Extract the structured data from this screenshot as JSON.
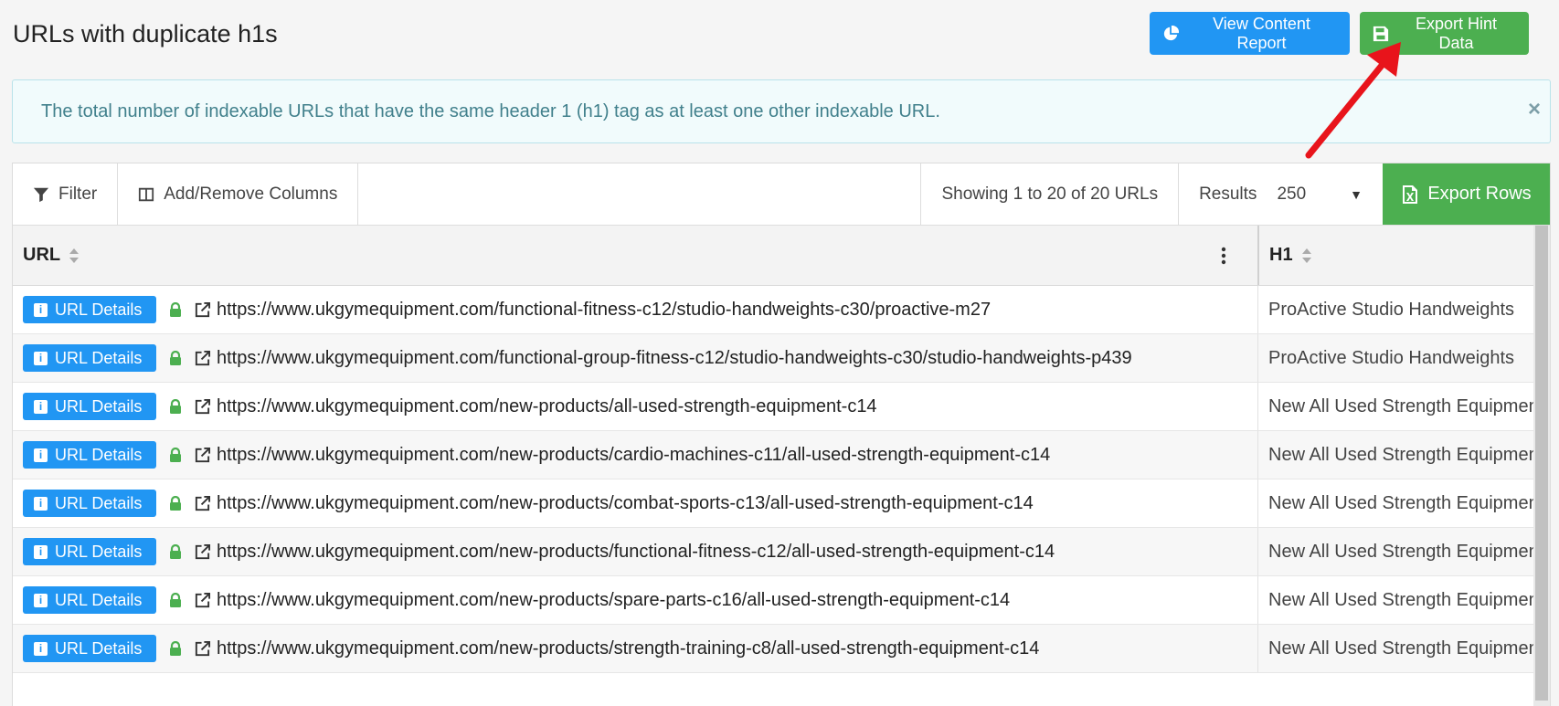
{
  "header": {
    "title": "URLs with duplicate h1s",
    "view_report_label": "View Content Report",
    "export_hint_label": "Export Hint Data"
  },
  "alert": {
    "text": "The total number of indexable URLs that have the same header 1 (h1) tag as at least one other indexable URL.",
    "close_glyph": "×"
  },
  "toolbar": {
    "filter_label": "Filter",
    "columns_label": "Add/Remove Columns",
    "showing_text": "Showing 1 to 20 of 20 URLs",
    "results_label": "Results",
    "results_value": "250",
    "export_rows_label": "Export Rows"
  },
  "table": {
    "columns": {
      "url": "URL",
      "h1": "H1"
    },
    "details_label": "URL Details",
    "rows": [
      {
        "url": "https://www.ukgymequipment.com/functional-fitness-c12/studio-handweights-c30/proactive-m27",
        "h1": "ProActive Studio Handweights"
      },
      {
        "url": "https://www.ukgymequipment.com/functional-group-fitness-c12/studio-handweights-c30/studio-handweights-p439",
        "h1": "ProActive Studio Handweights"
      },
      {
        "url": "https://www.ukgymequipment.com/new-products/all-used-strength-equipment-c14",
        "h1": "New All Used Strength Equipment"
      },
      {
        "url": "https://www.ukgymequipment.com/new-products/cardio-machines-c11/all-used-strength-equipment-c14",
        "h1": "New All Used Strength Equipment"
      },
      {
        "url": "https://www.ukgymequipment.com/new-products/combat-sports-c13/all-used-strength-equipment-c14",
        "h1": "New All Used Strength Equipment"
      },
      {
        "url": "https://www.ukgymequipment.com/new-products/functional-fitness-c12/all-used-strength-equipment-c14",
        "h1": "New All Used Strength Equipment"
      },
      {
        "url": "https://www.ukgymequipment.com/new-products/spare-parts-c16/all-used-strength-equipment-c14",
        "h1": "New All Used Strength Equipment"
      },
      {
        "url": "https://www.ukgymequipment.com/new-products/strength-training-c8/all-used-strength-equipment-c14",
        "h1": "New All Used Strength Equipment"
      }
    ]
  },
  "colors": {
    "primary_blue": "#2196f3",
    "success_green": "#4caf50",
    "alert_text": "#41808c",
    "annotation_red": "#e8141b"
  },
  "icons": {
    "view_report": "pie-chart-icon",
    "export_hint": "floppy-disk-icon",
    "filter": "funnel-icon",
    "columns": "columns-icon",
    "export_rows": "excel-file-icon",
    "row_secure": "lock-icon",
    "row_external": "external-link-icon"
  }
}
